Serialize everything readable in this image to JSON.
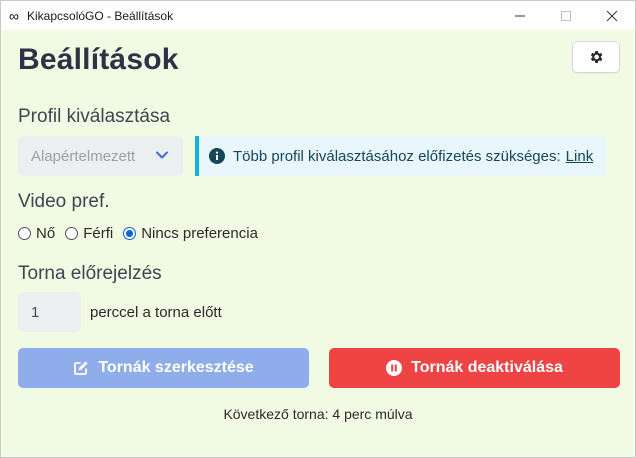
{
  "window": {
    "title": "KikapcsolóGO - Beállítások",
    "app_icon": "infinity-icon"
  },
  "page": {
    "title": "Beállítások"
  },
  "profile": {
    "label": "Profil kiválasztása",
    "selected": "Alapértelmezett",
    "info_text": "Több profil kiválasztásához előfizetés szükséges:",
    "info_link": "Link"
  },
  "video": {
    "label": "Video pref.",
    "options": [
      {
        "label": "Nő",
        "checked": false
      },
      {
        "label": "Férfi",
        "checked": false
      },
      {
        "label": "Nincs preferencia",
        "checked": true
      }
    ]
  },
  "reminder": {
    "label": "Torna előrejelzés",
    "value": "1",
    "suffix": "perccel a torna előtt"
  },
  "buttons": {
    "edit_label": "Tornák szerkesztése",
    "deactivate_label": "Tornák deaktiválása"
  },
  "status": {
    "next_tournament": "Következő torna: 4 perc múlva"
  },
  "colors": {
    "background": "#f1fbe4",
    "edit_button": "#8eadea",
    "deactivate_button": "#ef4444",
    "info_accent": "#14b3d9",
    "title": "#2b3344"
  }
}
